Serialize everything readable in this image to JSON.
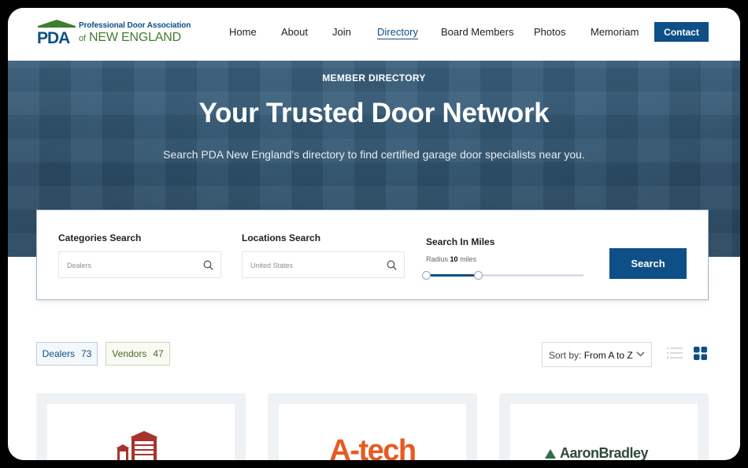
{
  "header": {
    "logo": {
      "abbr": "PDA",
      "line1": "Professional Door Association",
      "line2_of": "of",
      "line2": "NEW ENGLAND"
    },
    "nav": [
      {
        "label": "Home",
        "active": false
      },
      {
        "label": "About",
        "active": false
      },
      {
        "label": "Join",
        "active": false
      },
      {
        "label": "Directory",
        "active": true
      },
      {
        "label": "Board Members",
        "active": false
      },
      {
        "label": "Photos",
        "active": false
      },
      {
        "label": "Memoriam",
        "active": false
      }
    ],
    "contact_label": "Contact"
  },
  "hero": {
    "eyebrow": "MEMBER DIRECTORY",
    "title": "Your Trusted Door Network",
    "subtitle": "Search PDA New England's directory to find certified garage door specialists near you."
  },
  "search": {
    "categories_label": "Categories Search",
    "categories_placeholder": "Dealers",
    "locations_label": "Locations Search",
    "locations_placeholder": "United States",
    "miles_label": "Search In Miles",
    "radius_prefix": "Radius",
    "radius_value": "10",
    "radius_suffix": "miles",
    "slider_fraction": 0.33,
    "button_label": "Search"
  },
  "filters": {
    "dealers_label": "Dealers",
    "dealers_count": "73",
    "vendors_label": "Vendors",
    "vendors_count": "47",
    "sort_prefix": "Sort by:",
    "sort_value": "From A to Z"
  },
  "cards": [
    {
      "logo_text": ""
    },
    {
      "logo_text": "A-tech"
    },
    {
      "logo_text": "AaronBradley"
    }
  ],
  "colors": {
    "brand_blue": "#0d4f86",
    "brand_green": "#3f7d2f",
    "atech_orange": "#e85a22"
  }
}
